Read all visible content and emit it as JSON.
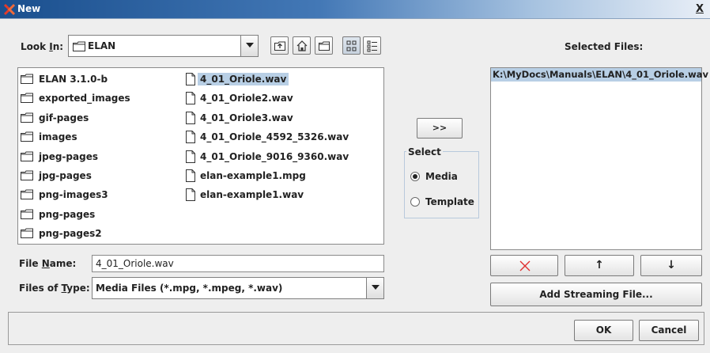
{
  "window": {
    "title": "New",
    "close_label": "X"
  },
  "look_in": {
    "label_prefix": "Look ",
    "label_mnemonic": "I",
    "label_suffix": "n:",
    "value": "ELAN"
  },
  "files": {
    "folders": [
      "ELAN 3.1.0-b",
      "exported_images",
      "gif-pages",
      "images",
      "jpeg-pages",
      "jpg-pages",
      "png-images3",
      "png-pages",
      "png-pages2"
    ],
    "documents": [
      "4_01_Oriole.wav",
      "4_01_Oriole2.wav",
      "4_01_Oriole3.wav",
      "4_01_Oriole_4592_5326.wav",
      "4_01_Oriole_9016_9360.wav",
      "elan-example1.mpg",
      "elan-example1.wav"
    ],
    "selected_index": 0
  },
  "file_name": {
    "label_prefix": "File ",
    "label_mnemonic": "N",
    "label_suffix": "ame:",
    "value": "4_01_Oriole.wav"
  },
  "files_of_type": {
    "label_prefix": "Files of ",
    "label_mnemonic": "T",
    "label_suffix": "ype:",
    "value": "Media Files (*.mpg, *.mpeg, *.wav)"
  },
  "transfer": {
    "add_label": ">>"
  },
  "select_group": {
    "title": "Select",
    "options": [
      "Media",
      "Template"
    ],
    "selected": "Media"
  },
  "selected_files": {
    "title": "Selected Files:",
    "items": [
      "K:\\MyDocs\\Manuals\\ELAN\\4_01_Oriole.wav"
    ],
    "move_up_label": "↑",
    "move_down_label": "↓",
    "add_streaming_label": "Add Streaming File..."
  },
  "footer": {
    "ok_label": "OK",
    "cancel_label": "Cancel"
  },
  "colors": {
    "selection": "#b8cfe5",
    "remove_icon": "#e03030"
  }
}
